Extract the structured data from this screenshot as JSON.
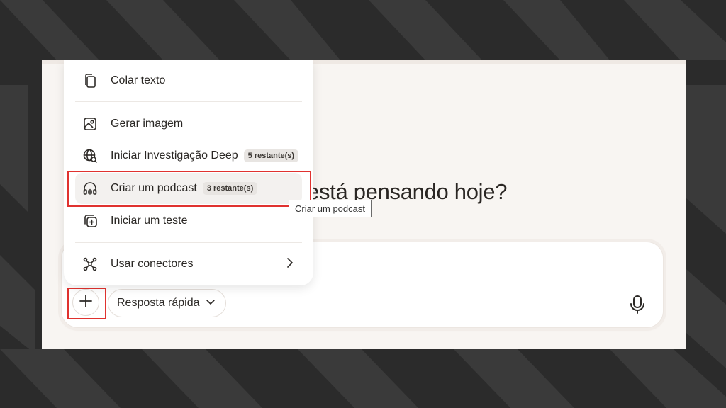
{
  "headline": "está pensando hoje?",
  "menu": {
    "items": [
      {
        "label": "Colar texto",
        "icon": "clipboard-icon"
      },
      {
        "label": "Gerar imagem",
        "icon": "image-icon"
      },
      {
        "label": "Iniciar Investigação Deep",
        "icon": "globe-search-icon",
        "badge": "5 restante(s)"
      },
      {
        "label": "Criar um podcast",
        "icon": "headphones-icon",
        "badge": "3 restante(s)"
      },
      {
        "label": "Iniciar um teste",
        "icon": "quiz-add-icon"
      },
      {
        "label": "Usar conectores",
        "icon": "connectors-icon"
      }
    ]
  },
  "tooltip": "Criar um podcast",
  "composer": {
    "mode_label": "Resposta rápida",
    "icons": [
      "plus-icon",
      "chevron-down-icon",
      "microphone-icon"
    ]
  },
  "colors": {
    "highlight": "#e0322f",
    "background": "#2b2b2b",
    "surface": "#f8f5f2"
  }
}
